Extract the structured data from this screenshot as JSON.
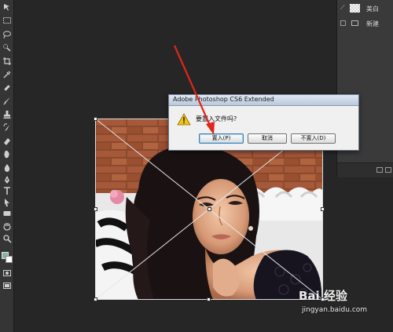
{
  "dialog": {
    "title": "Adobe Photoshop CS6 Extended",
    "message": "要置入文件吗?",
    "buttons": {
      "place": "置入(P)",
      "cancel": "取消",
      "dont_place": "不置入(D)"
    }
  },
  "layers_panel": {
    "items": [
      {
        "label": "美白",
        "icon": "layer-thumbnail"
      },
      {
        "label": "新建",
        "icon": "folder-icon"
      }
    ]
  },
  "tools": [
    "move-tool-icon",
    "marquee-tool-icon",
    "lasso-tool-icon",
    "quick-select-tool-icon",
    "crop-tool-icon",
    "eyedropper-tool-icon",
    "healing-brush-tool-icon",
    "brush-tool-icon",
    "clone-stamp-tool-icon",
    "history-brush-tool-icon",
    "eraser-tool-icon",
    "gradient-tool-icon",
    "blur-tool-icon",
    "dodge-tool-icon",
    "pen-tool-icon",
    "type-tool-icon",
    "path-select-tool-icon",
    "shape-tool-icon",
    "hand-tool-icon",
    "zoom-tool-icon"
  ],
  "colors": {
    "foreground": "#89b3a1",
    "background": "#ffffff",
    "annotation_arrow": "#e0251b"
  },
  "watermark": {
    "logo": "Bai 经验",
    "url": "jingyan.baidu.com"
  }
}
